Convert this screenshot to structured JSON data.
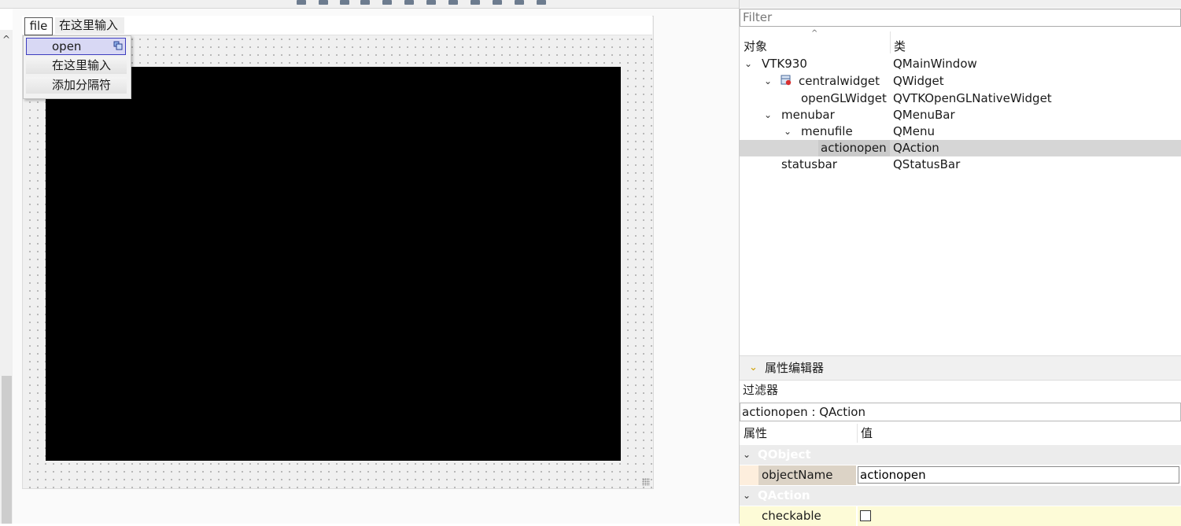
{
  "menubar": {
    "file_label": "file",
    "type_here_label": "在这里输入"
  },
  "dropdown": {
    "items": [
      {
        "label": "open",
        "selected": true
      },
      {
        "label": "在这里输入"
      },
      {
        "label": "添加分隔符"
      }
    ]
  },
  "object_inspector": {
    "filter_placeholder": "Filter",
    "columns": {
      "object": "对象",
      "class": "类"
    },
    "rows": [
      {
        "object": "VTK930",
        "class": "QMainWindow",
        "expanded": true
      },
      {
        "object": "centralwidget",
        "class": "QWidget",
        "expanded": true,
        "icon": "widget-layout-icon"
      },
      {
        "object": "openGLWidget",
        "class": "QVTKOpenGLNativeWidget"
      },
      {
        "object": "menubar",
        "class": "QMenuBar",
        "expanded": true
      },
      {
        "object": "menufile",
        "class": "QMenu",
        "expanded": true
      },
      {
        "object": "actionopen",
        "class": "QAction",
        "selected": true
      },
      {
        "object": "statusbar",
        "class": "QStatusBar"
      }
    ]
  },
  "property_editor": {
    "title": "属性编辑器",
    "filter_label": "过滤器",
    "object_label": "actionopen : QAction",
    "columns": {
      "property": "属性",
      "value": "值"
    },
    "groups": {
      "qobject": "QObject",
      "qaction": "QAction"
    },
    "object_name": {
      "name": "objectName",
      "value": "actionopen"
    },
    "checkable": {
      "name": "checkable",
      "checked": false
    }
  },
  "colors": {
    "accent_selection": "#d8d8f4",
    "accent_border": "#3d3dbf",
    "chevron_accent": "#d0a000"
  }
}
